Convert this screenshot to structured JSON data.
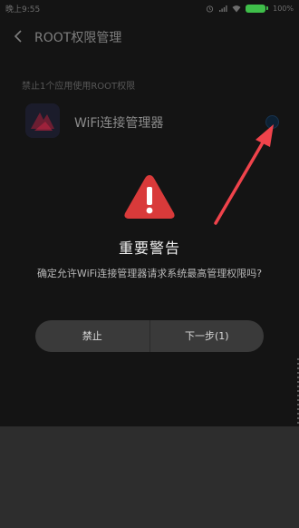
{
  "status_bar": {
    "time": "晚上9:55",
    "battery_percent": "100%"
  },
  "header": {
    "title": "ROOT权限管理"
  },
  "section": {
    "caption": "禁止1个应用使用ROOT权限"
  },
  "app_row": {
    "name": "WiFi连接管理器",
    "root_enabled": false
  },
  "dialog": {
    "title": "重要警告",
    "message": "确定允许WiFi连接管理器请求系统最高管理权限吗?",
    "deny_label": "禁止",
    "next_label": "下一步(1)"
  },
  "colors": {
    "warning_red": "#d93a3a",
    "annotation_arrow": "#f0434b",
    "battery_green": "#3fbf4a"
  }
}
